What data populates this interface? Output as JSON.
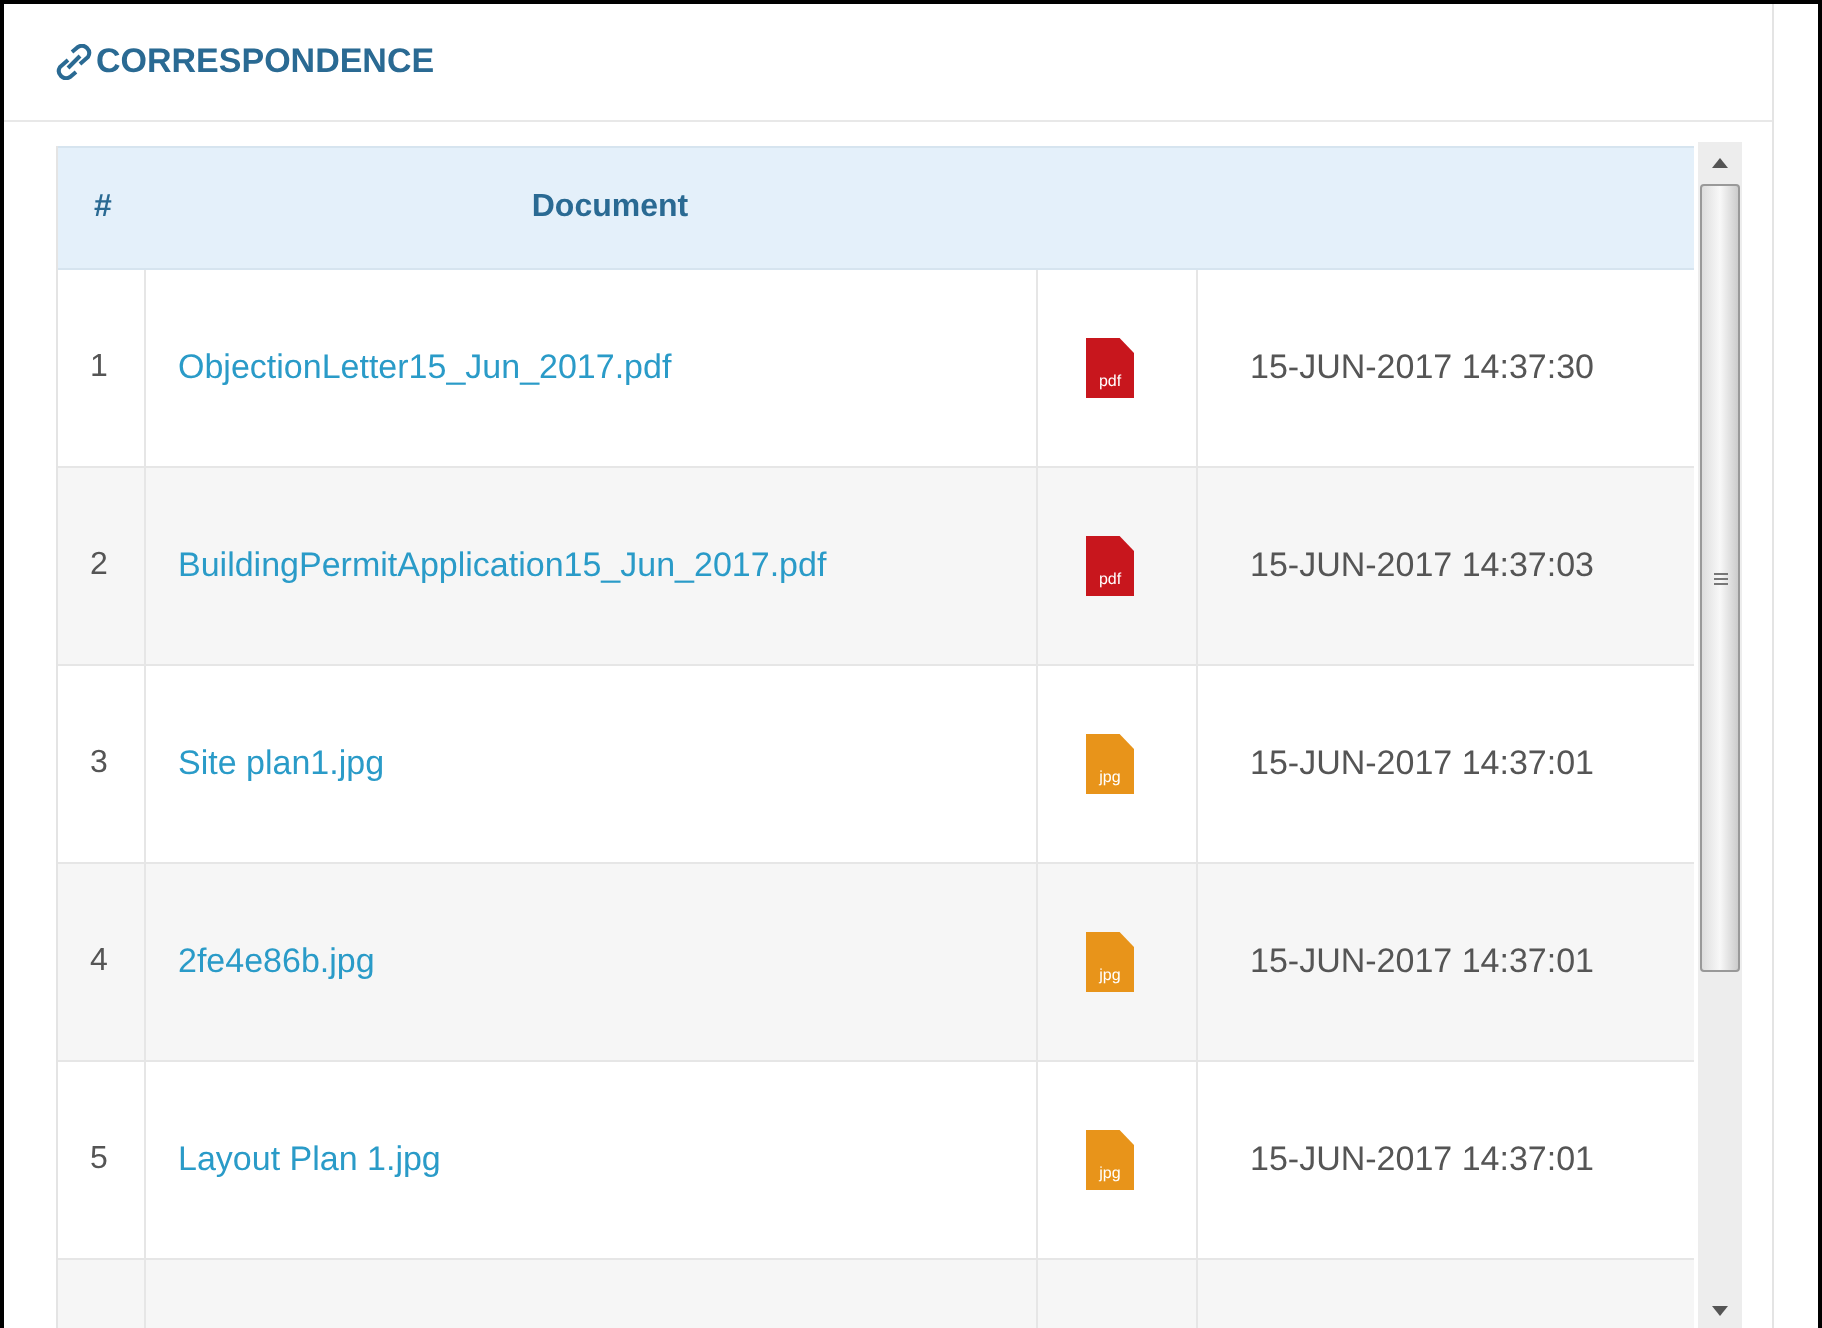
{
  "panel": {
    "title": "CORRESPONDENCE"
  },
  "table": {
    "columns": [
      "#",
      "Document"
    ],
    "rows": [
      {
        "number": "1",
        "document": "ObjectionLetter15_Jun_2017.pdf",
        "kind": "pdf",
        "icon_label": "pdf",
        "date": "15-JUN-2017 14:37:30"
      },
      {
        "number": "2",
        "document": "BuildingPermitApplication15_Jun_2017.pdf",
        "kind": "pdf",
        "icon_label": "pdf",
        "date": "15-JUN-2017 14:37:03"
      },
      {
        "number": "3",
        "document": "Site plan1.jpg",
        "kind": "jpg",
        "icon_label": "jpg",
        "date": "15-JUN-2017 14:37:01"
      },
      {
        "number": "4",
        "document": "2fe4e86b.jpg",
        "kind": "jpg",
        "icon_label": "jpg",
        "date": "15-JUN-2017 14:37:01"
      },
      {
        "number": "5",
        "document": "Layout Plan 1.jpg",
        "kind": "jpg",
        "icon_label": "jpg",
        "date": "15-JUN-2017 14:37:01"
      }
    ]
  }
}
